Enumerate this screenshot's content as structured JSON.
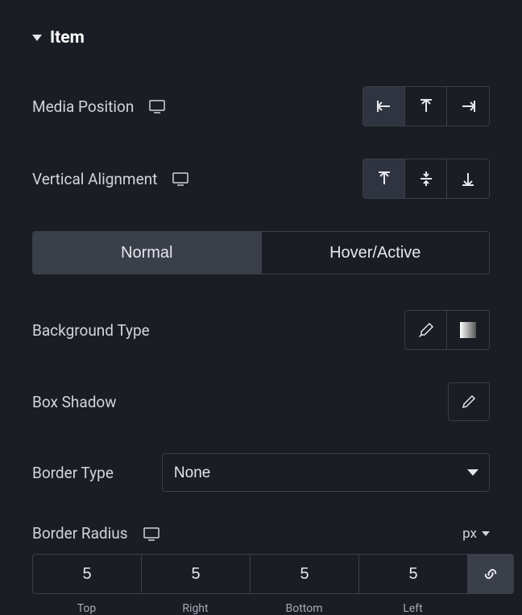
{
  "section": {
    "title": "Item"
  },
  "mediaPosition": {
    "label": "Media Position",
    "selected": "left"
  },
  "verticalAlignment": {
    "label": "Vertical Alignment",
    "selected": "top"
  },
  "tabs": {
    "normal": "Normal",
    "hover": "Hover/Active",
    "active": "normal"
  },
  "backgroundType": {
    "label": "Background Type"
  },
  "boxShadow": {
    "label": "Box Shadow"
  },
  "borderType": {
    "label": "Border Type",
    "value": "None"
  },
  "borderRadius": {
    "label": "Border Radius",
    "unit": "px",
    "top": "5",
    "right": "5",
    "bottom": "5",
    "left": "5",
    "topLabel": "Top",
    "rightLabel": "Right",
    "bottomLabel": "Bottom",
    "leftLabel": "Left",
    "linked": true
  }
}
